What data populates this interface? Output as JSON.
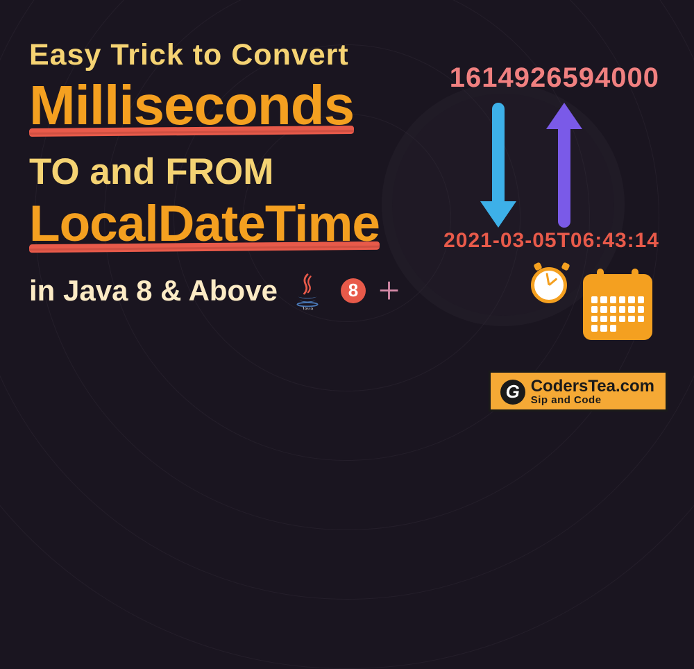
{
  "title": {
    "line1": "Easy Trick to Convert",
    "line2": "Milliseconds",
    "line3": "TO and FROM",
    "line4": "LocalDateTime",
    "line5": "in Java 8 & Above"
  },
  "conversion": {
    "milliseconds": "1614926594000",
    "datetime": "2021-03-05T06:43:14"
  },
  "java": {
    "version_badge": "8",
    "plus": "+",
    "label": "Java"
  },
  "brand": {
    "logo_letter": "G",
    "name": "CodersTea.com",
    "tagline": "Sip and Code"
  },
  "colors": {
    "yellow": "#f5d373",
    "orange": "#f4a020",
    "coral": "#e85a4a",
    "salmon": "#f08080",
    "blue": "#3db0e8",
    "purple": "#7a5ae8",
    "cream": "#fcebc5",
    "badge_orange": "#f5a935"
  }
}
